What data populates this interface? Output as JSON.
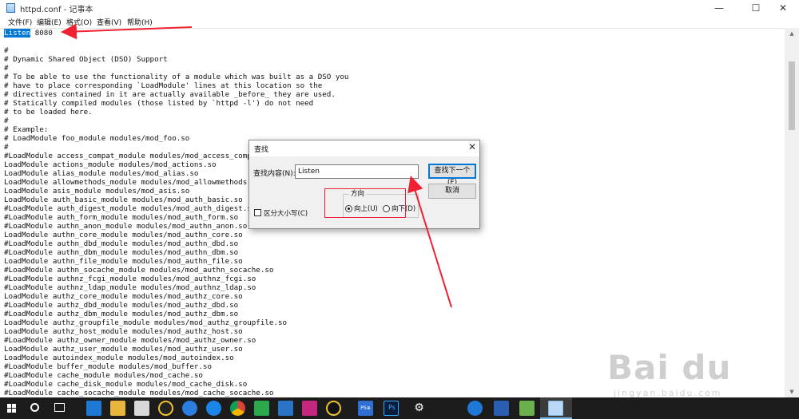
{
  "window": {
    "title": "httpd.conf - 记事本",
    "minimize": "—",
    "maximize": "☐",
    "close": "✕"
  },
  "menu": [
    {
      "label": "文件(F)"
    },
    {
      "label": "编辑(E)"
    },
    {
      "label": "格式(O)"
    },
    {
      "label": "查看(V)"
    },
    {
      "label": "帮助(H)"
    }
  ],
  "editor": {
    "selected": "Listen",
    "first_line_rest": " 8080",
    "lines": [
      "",
      "#",
      "# Dynamic Shared Object (DSO) Support",
      "#",
      "# To be able to use the functionality of a module which was built as a DSO you",
      "# have to place corresponding `LoadModule' lines at this location so the",
      "# directives contained in it are actually available _before_ they are used.",
      "# Statically compiled modules (those listed by `httpd -l') do not need",
      "# to be loaded here.",
      "#",
      "# Example:",
      "# LoadModule foo_module modules/mod_foo.so",
      "#",
      "#LoadModule access_compat_module modules/mod_access_compat.so",
      "LoadModule actions_module modules/mod_actions.so",
      "LoadModule alias_module modules/mod_alias.so",
      "LoadModule allowmethods_module modules/mod_allowmethods.so",
      "LoadModule asis_module modules/mod_asis.so",
      "LoadModule auth_basic_module modules/mod_auth_basic.so",
      "#LoadModule auth_digest_module modules/mod_auth_digest.so",
      "#LoadModule auth_form_module modules/mod_auth_form.so",
      "#LoadModule authn_anon_module modules/mod_authn_anon.so",
      "LoadModule authn_core_module modules/mod_authn_core.so",
      "#LoadModule authn_dbd_module modules/mod_authn_dbd.so",
      "#LoadModule authn_dbm_module modules/mod_authn_dbm.so",
      "LoadModule authn_file_module modules/mod_authn_file.so",
      "#LoadModule authn_socache_module modules/mod_authn_socache.so",
      "#LoadModule authnz_fcgi_module modules/mod_authnz_fcgi.so",
      "#LoadModule authnz_ldap_module modules/mod_authnz_ldap.so",
      "LoadModule authz_core_module modules/mod_authz_core.so",
      "#LoadModule authz_dbd_module modules/mod_authz_dbd.so",
      "#LoadModule authz_dbm_module modules/mod_authz_dbm.so",
      "LoadModule authz_groupfile_module modules/mod_authz_groupfile.so",
      "LoadModule authz_host_module modules/mod_authz_host.so",
      "#LoadModule authz_owner_module modules/mod_authz_owner.so",
      "LoadModule authz_user_module modules/mod_authz_user.so",
      "LoadModule autoindex_module modules/mod_autoindex.so",
      "#LoadModule buffer_module modules/mod_buffer.so",
      "#LoadModule cache_module modules/mod_cache.so",
      "#LoadModule cache_disk_module modules/mod_cache_disk.so",
      "#LoadModule cache_socache_module modules/mod_cache_socache.so"
    ]
  },
  "find_dialog": {
    "title": "查找",
    "close": "✕",
    "find_label": "查找内容(N):",
    "find_value": "Listen",
    "find_next": "查找下一个(F)",
    "cancel": "取消",
    "direction_label": "方向",
    "up_label": "向上(U)",
    "down_label": "向下(D)",
    "match_case_label": "区分大小写(C)"
  },
  "watermark": {
    "logo": "Bai du",
    "sub": "jingyan.baidu.com"
  },
  "taskbar": {
    "ps_text": "Ps",
    "pm_text": "PS⊕"
  },
  "colors": {
    "selection": "#0078d7",
    "annotation": "#e23",
    "taskbar": "#1c1c1c"
  }
}
